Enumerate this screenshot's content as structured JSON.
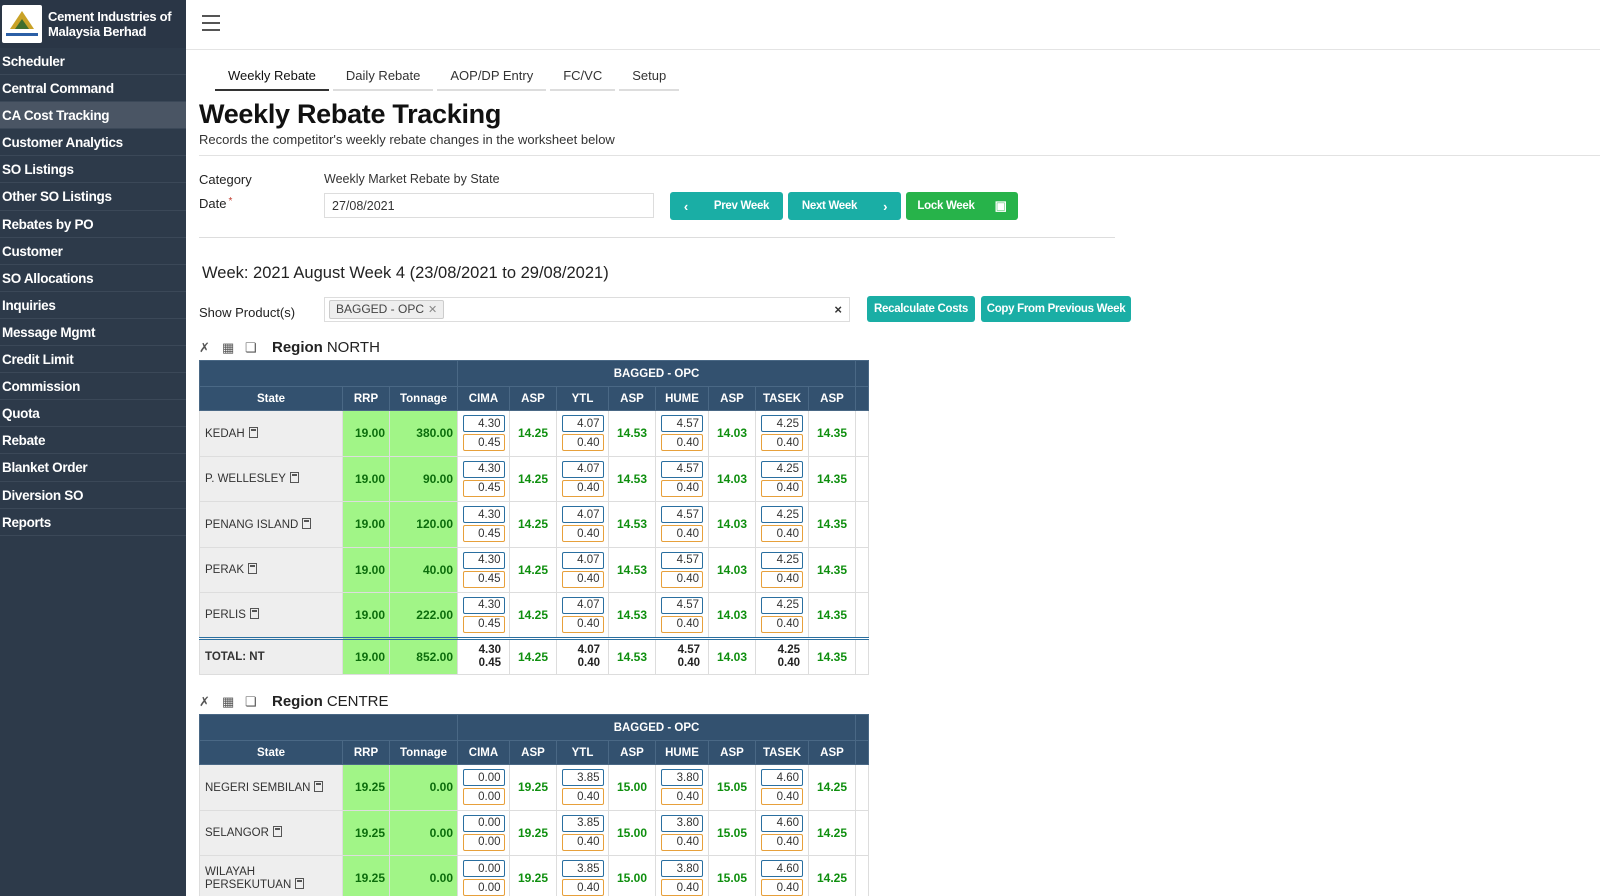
{
  "brand": {
    "name_line1": "Cement Industries of",
    "name_line2": "Malaysia Berhad"
  },
  "nav": [
    "Scheduler",
    "Central Command",
    "CA Cost Tracking",
    "Customer Analytics",
    "SO Listings",
    "Other SO Listings",
    "Rebates by PO",
    "Customer",
    "SO Allocations",
    "Inquiries",
    "Message Mgmt",
    "Credit Limit",
    "Commission",
    "Quota",
    "Rebate",
    "Blanket Order",
    "Diversion SO",
    "Reports"
  ],
  "tabs": [
    "Weekly Rebate",
    "Daily Rebate",
    "AOP/DP Entry",
    "FC/VC",
    "Setup"
  ],
  "page": {
    "title": "Weekly Rebate Tracking",
    "subtitle": "Records the competitor's weekly rebate changes in the worksheet below"
  },
  "form": {
    "category_label": "Category",
    "category_value": "Weekly Market Rebate by State",
    "date_label": "Date",
    "required_mark": "*",
    "date_value": "27/08/2021"
  },
  "buttons": {
    "prev_week": "Prev Week",
    "next_week": "Next Week",
    "lock_week": "Lock Week",
    "recalc": "Recalculate Costs",
    "copy_prev": "Copy From Previous Week"
  },
  "week_title": "Week: 2021 August Week 4 (23/08/2021 to 29/08/2021)",
  "products": {
    "label": "Show Product(s)",
    "selected": "BAGGED - OPC",
    "clear": "×"
  },
  "table_headers": {
    "group": "BAGGED - OPC",
    "state": "State",
    "rrp": "RRP",
    "tonnage": "Tonnage",
    "cima": "CIMA",
    "asp": "ASP",
    "ytl": "YTL",
    "hume": "HUME",
    "tasek": "TASEK"
  },
  "regions": {
    "north": {
      "label": "Region",
      "name": "NORTH",
      "rows": [
        {
          "state": "KEDAH",
          "rrp": "19.00",
          "tonnage": "380.00",
          "cima": [
            "4.30",
            "0.45"
          ],
          "asp1": "14.25",
          "ytl": [
            "4.07",
            "0.40"
          ],
          "asp2": "14.53",
          "hume": [
            "4.57",
            "0.40"
          ],
          "asp3": "14.03",
          "tasek": [
            "4.25",
            "0.40"
          ],
          "asp4": "14.35"
        },
        {
          "state": "P. WELLESLEY",
          "rrp": "19.00",
          "tonnage": "90.00",
          "cima": [
            "4.30",
            "0.45"
          ],
          "asp1": "14.25",
          "ytl": [
            "4.07",
            "0.40"
          ],
          "asp2": "14.53",
          "hume": [
            "4.57",
            "0.40"
          ],
          "asp3": "14.03",
          "tasek": [
            "4.25",
            "0.40"
          ],
          "asp4": "14.35"
        },
        {
          "state": "PENANG ISLAND",
          "rrp": "19.00",
          "tonnage": "120.00",
          "cima": [
            "4.30",
            "0.45"
          ],
          "asp1": "14.25",
          "ytl": [
            "4.07",
            "0.40"
          ],
          "asp2": "14.53",
          "hume": [
            "4.57",
            "0.40"
          ],
          "asp3": "14.03",
          "tasek": [
            "4.25",
            "0.40"
          ],
          "asp4": "14.35"
        },
        {
          "state": "PERAK",
          "rrp": "19.00",
          "tonnage": "40.00",
          "cima": [
            "4.30",
            "0.45"
          ],
          "asp1": "14.25",
          "ytl": [
            "4.07",
            "0.40"
          ],
          "asp2": "14.53",
          "hume": [
            "4.57",
            "0.40"
          ],
          "asp3": "14.03",
          "tasek": [
            "4.25",
            "0.40"
          ],
          "asp4": "14.35"
        },
        {
          "state": "PERLIS",
          "rrp": "19.00",
          "tonnage": "222.00",
          "cima": [
            "4.30",
            "0.45"
          ],
          "asp1": "14.25",
          "ytl": [
            "4.07",
            "0.40"
          ],
          "asp2": "14.53",
          "hume": [
            "4.57",
            "0.40"
          ],
          "asp3": "14.03",
          "tasek": [
            "4.25",
            "0.40"
          ],
          "asp4": "14.35"
        }
      ],
      "total": {
        "state": "TOTAL: NT",
        "rrp": "19.00",
        "tonnage": "852.00",
        "cima": [
          "4.30",
          "0.45"
        ],
        "asp1": "14.25",
        "ytl": [
          "4.07",
          "0.40"
        ],
        "asp2": "14.53",
        "hume": [
          "4.57",
          "0.40"
        ],
        "asp3": "14.03",
        "tasek": [
          "4.25",
          "0.40"
        ],
        "asp4": "14.35"
      }
    },
    "centre": {
      "label": "Region",
      "name": "CENTRE",
      "rows": [
        {
          "state": "NEGERI SEMBILAN",
          "rrp": "19.25",
          "tonnage": "0.00",
          "cima": [
            "0.00",
            "0.00"
          ],
          "asp1": "19.25",
          "ytl": [
            "3.85",
            "0.40"
          ],
          "asp2": "15.00",
          "hume": [
            "3.80",
            "0.40"
          ],
          "asp3": "15.05",
          "tasek": [
            "4.60",
            "0.40"
          ],
          "asp4": "14.25"
        },
        {
          "state": "SELANGOR",
          "rrp": "19.25",
          "tonnage": "0.00",
          "cima": [
            "0.00",
            "0.00"
          ],
          "asp1": "19.25",
          "ytl": [
            "3.85",
            "0.40"
          ],
          "asp2": "15.00",
          "hume": [
            "3.80",
            "0.40"
          ],
          "asp3": "15.05",
          "tasek": [
            "4.60",
            "0.40"
          ],
          "asp4": "14.25"
        },
        {
          "state": "WILAYAH PERSEKUTUAN",
          "rrp": "19.25",
          "tonnage": "0.00",
          "cima": [
            "0.00",
            "0.00"
          ],
          "asp1": "19.25",
          "ytl": [
            "3.85",
            "0.40"
          ],
          "asp2": "15.00",
          "hume": [
            "3.80",
            "0.40"
          ],
          "asp3": "15.05",
          "tasek": [
            "4.60",
            "0.40"
          ],
          "asp4": "14.25"
        }
      ]
    }
  }
}
